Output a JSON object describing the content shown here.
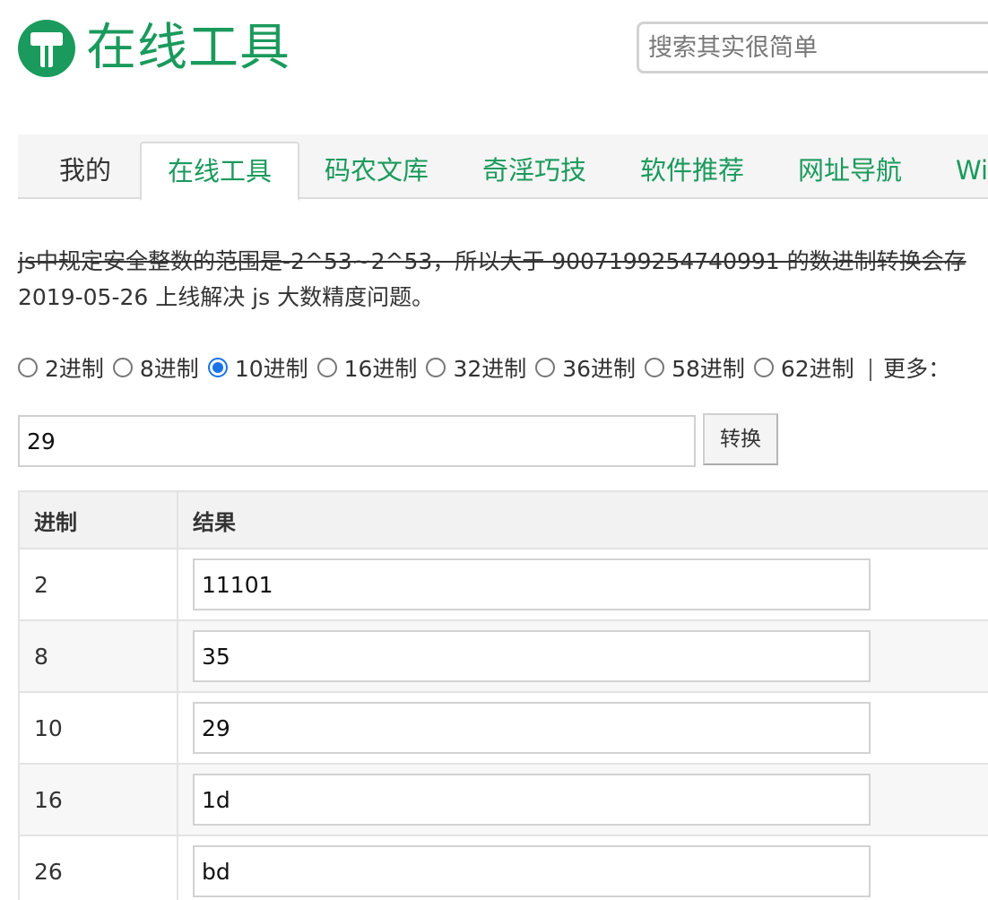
{
  "header": {
    "logo_text": "在线工具",
    "search_placeholder": "搜索其实很简单"
  },
  "nav": {
    "items": [
      {
        "label": "我的"
      },
      {
        "label": "在线工具"
      },
      {
        "label": "码农文库"
      },
      {
        "label": "奇淫巧技"
      },
      {
        "label": "软件推荐"
      },
      {
        "label": "网址导航"
      },
      {
        "label": "Wi"
      }
    ]
  },
  "notice": {
    "strike_text": "js中规定安全整数的范围是-2^53~2^53，所以大于 9007199254740991 的数进制转换会存",
    "update_text": "2019-05-26 上线解决 js 大数精度问题。"
  },
  "radios": {
    "options": [
      {
        "label": "2进制",
        "checked": false
      },
      {
        "label": "8进制",
        "checked": false
      },
      {
        "label": "10进制",
        "checked": true
      },
      {
        "label": "16进制",
        "checked": false
      },
      {
        "label": "32进制",
        "checked": false
      },
      {
        "label": "36进制",
        "checked": false
      },
      {
        "label": "58进制",
        "checked": false
      },
      {
        "label": "62进制",
        "checked": false
      }
    ],
    "separator": "|",
    "more_label": "更多："
  },
  "converter": {
    "input_value": "29",
    "button_label": "转换"
  },
  "results": {
    "headers": {
      "base": "进制",
      "result": "结果"
    },
    "rows": [
      {
        "base": "2",
        "value": "11101"
      },
      {
        "base": "8",
        "value": "35"
      },
      {
        "base": "10",
        "value": "29"
      },
      {
        "base": "16",
        "value": "1d"
      },
      {
        "base": "26",
        "value": "bd"
      }
    ]
  },
  "colors": {
    "brand_green": "#1a9a5c",
    "radio_blue": "#1a73e8"
  }
}
